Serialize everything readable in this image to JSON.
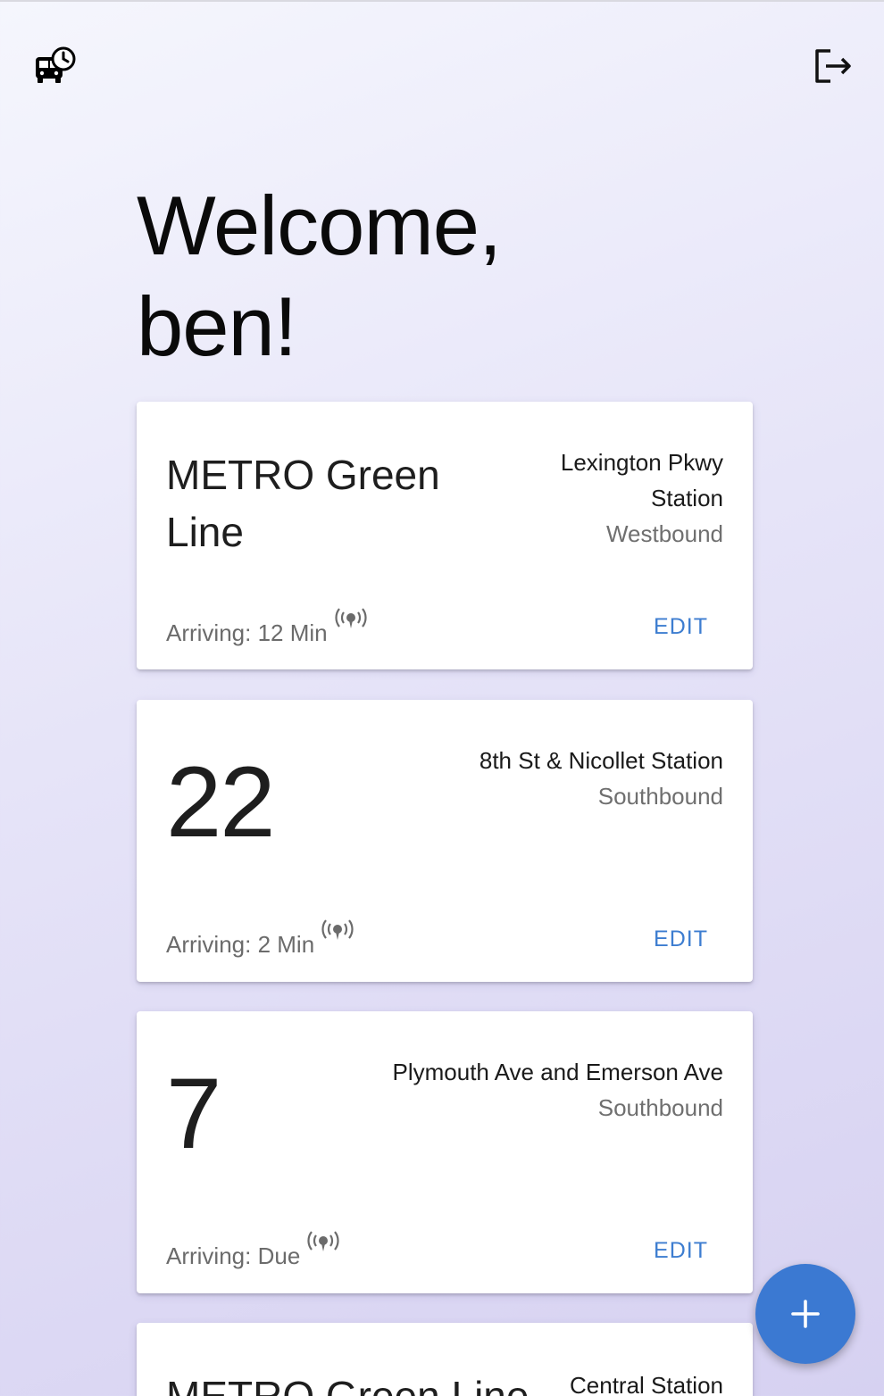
{
  "header": {
    "app_icon": "bus-clock-icon",
    "logout_icon": "logout-icon"
  },
  "welcome": {
    "line1": "Welcome,",
    "line2": "ben!"
  },
  "cards": [
    {
      "route": "METRO Green Line",
      "stop": "Lexington Pkwy Station",
      "direction": "Westbound",
      "arriving": "Arriving: 12 Min",
      "edit_label": "EDIT"
    },
    {
      "route": "22",
      "stop": "8th St & Nicollet Station",
      "direction": "Southbound",
      "arriving": "Arriving: 2 Min",
      "edit_label": "EDIT"
    },
    {
      "route": "7",
      "stop": "Plymouth Ave and Emerson Ave",
      "direction": "Southbound",
      "arriving": "Arriving: Due",
      "edit_label": "EDIT"
    },
    {
      "route": "METRO Green Line",
      "stop": "Central Station",
      "direction": "",
      "arriving": "",
      "edit_label": ""
    }
  ],
  "fab": {
    "icon": "plus-icon",
    "color": "#3b79d2"
  },
  "colors": {
    "accent": "#3d7dd0",
    "realtime_signal": "#6b6b6b"
  }
}
